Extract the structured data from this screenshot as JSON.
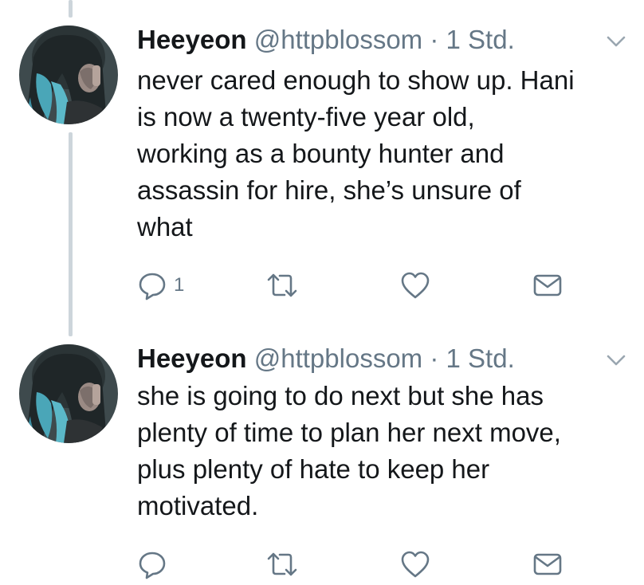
{
  "tweets": [
    {
      "name": "Heeyeon",
      "handle": "@httpblossom",
      "separator": "·",
      "time": "1 Std.",
      "text_lines": [
        "never cared enough to show up. Hani",
        "is now a twenty-five year old,",
        "working as a bounty hunter and",
        "assassin for hire, she’s unsure of",
        "what"
      ],
      "reply_count": "1",
      "icons": [
        "reply-icon",
        "retweet-icon",
        "like-icon",
        "direct-message-icon",
        "chevron-down-icon"
      ]
    },
    {
      "name": "Heeyeon",
      "handle": "@httpblossom",
      "separator": "·",
      "time": "1 Std.",
      "text_lines": [
        "she is going to do next but she has",
        "plenty of time to plan her next move,",
        "plus plenty of hate to keep her",
        "motivated."
      ],
      "reply_count": "",
      "icons": [
        "reply-icon",
        "retweet-icon",
        "like-icon",
        "direct-message-icon",
        "chevron-down-icon"
      ]
    }
  ],
  "colors": {
    "text": "#14171a",
    "secondary": "#657786",
    "icon": "#657786",
    "thread_line": "#cdd5db",
    "background": "#ffffff"
  }
}
